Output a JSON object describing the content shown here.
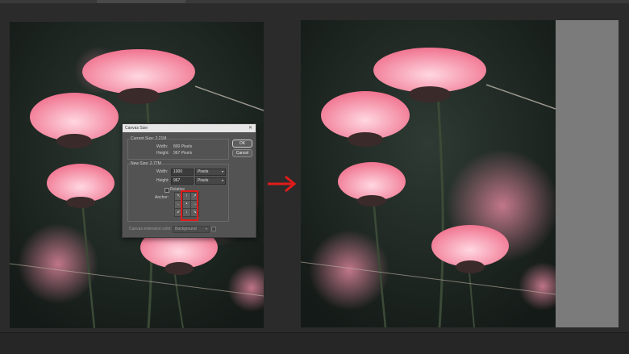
{
  "dialog": {
    "title": "Canvas Size",
    "close_glyph": "✕",
    "current_size_label": "Current Size: 2.21M",
    "current_width_label": "Width:",
    "current_width_value": "800 Pixels",
    "current_height_label": "Height:",
    "current_height_value": "967 Pixels",
    "new_size_label": "New Size: 2.77M",
    "new_width_label": "Width:",
    "new_width_value": "1000",
    "new_width_unit": "Pixels",
    "new_height_label": "Height:",
    "new_height_value": "967",
    "new_height_unit": "Pixels",
    "relative_label": "Relative",
    "anchor_label": "Anchor:",
    "extension_color_label": "Canvas extension color:",
    "extension_color_value": "Background",
    "ok_label": "OK",
    "cancel_label": "Cancel"
  },
  "anchor_cells": [
    "↖",
    "↑",
    "↗",
    "←",
    "•",
    "→",
    "↙",
    "↓",
    "↘"
  ],
  "colors": {
    "arrow": "#e01b1b",
    "highlight": "#e01b1b",
    "canvas_extension": "#7b7b7b"
  }
}
